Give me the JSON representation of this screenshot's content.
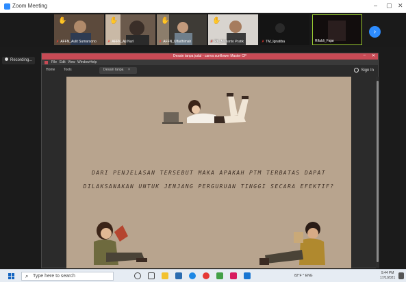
{
  "app": {
    "title": "Zoom Meeting",
    "window_controls": {
      "minimize": "–",
      "restore": "▢",
      "close": "✕"
    }
  },
  "participants": [
    {
      "name": "AFFN_Aulit Sumarsono",
      "hand_raised": true
    },
    {
      "name": "AFFN_Aji Nurl",
      "hand_raised": true
    },
    {
      "name": "AFFN_Ulfadhimah",
      "hand_raised": true
    },
    {
      "name": "PK_Mutianto Pratik",
      "hand_raised": true
    },
    {
      "name": "TM_Ignatiba",
      "hand_raised": false
    },
    {
      "name": "Rifaldi_Fajar",
      "hand_raised": false
    }
  ],
  "recording": {
    "label": "Recording..."
  },
  "browser": {
    "title": "Desain tanpa judul - canva sunflower Master CP",
    "menu": [
      "File",
      "Edit",
      "View",
      "Window",
      "Help"
    ],
    "tabs": [
      "Home",
      "Tools",
      "Desain tanpa"
    ],
    "sign_in": "Sign In"
  },
  "slide": {
    "line1": "DARI PENJELASAN TERSEBUT MAKA APAKAH PTM TERBATAS DAPAT",
    "line2": "DILAKSANAKAN UNTUK JENJANG PERGURUAN TINGGI SECARA EFEKTIF?",
    "background": "#b8a48e"
  },
  "taskbar": {
    "search_placeholder": "Type here to search",
    "tray": "82°F  ^  ENG",
    "clock": {
      "time": "9:44 PM",
      "date": "17/1/2021"
    }
  },
  "colors": {
    "zoom_blue": "#2d8cff",
    "browser_titlebar": "#c84a55",
    "hand": "#f5c518"
  }
}
